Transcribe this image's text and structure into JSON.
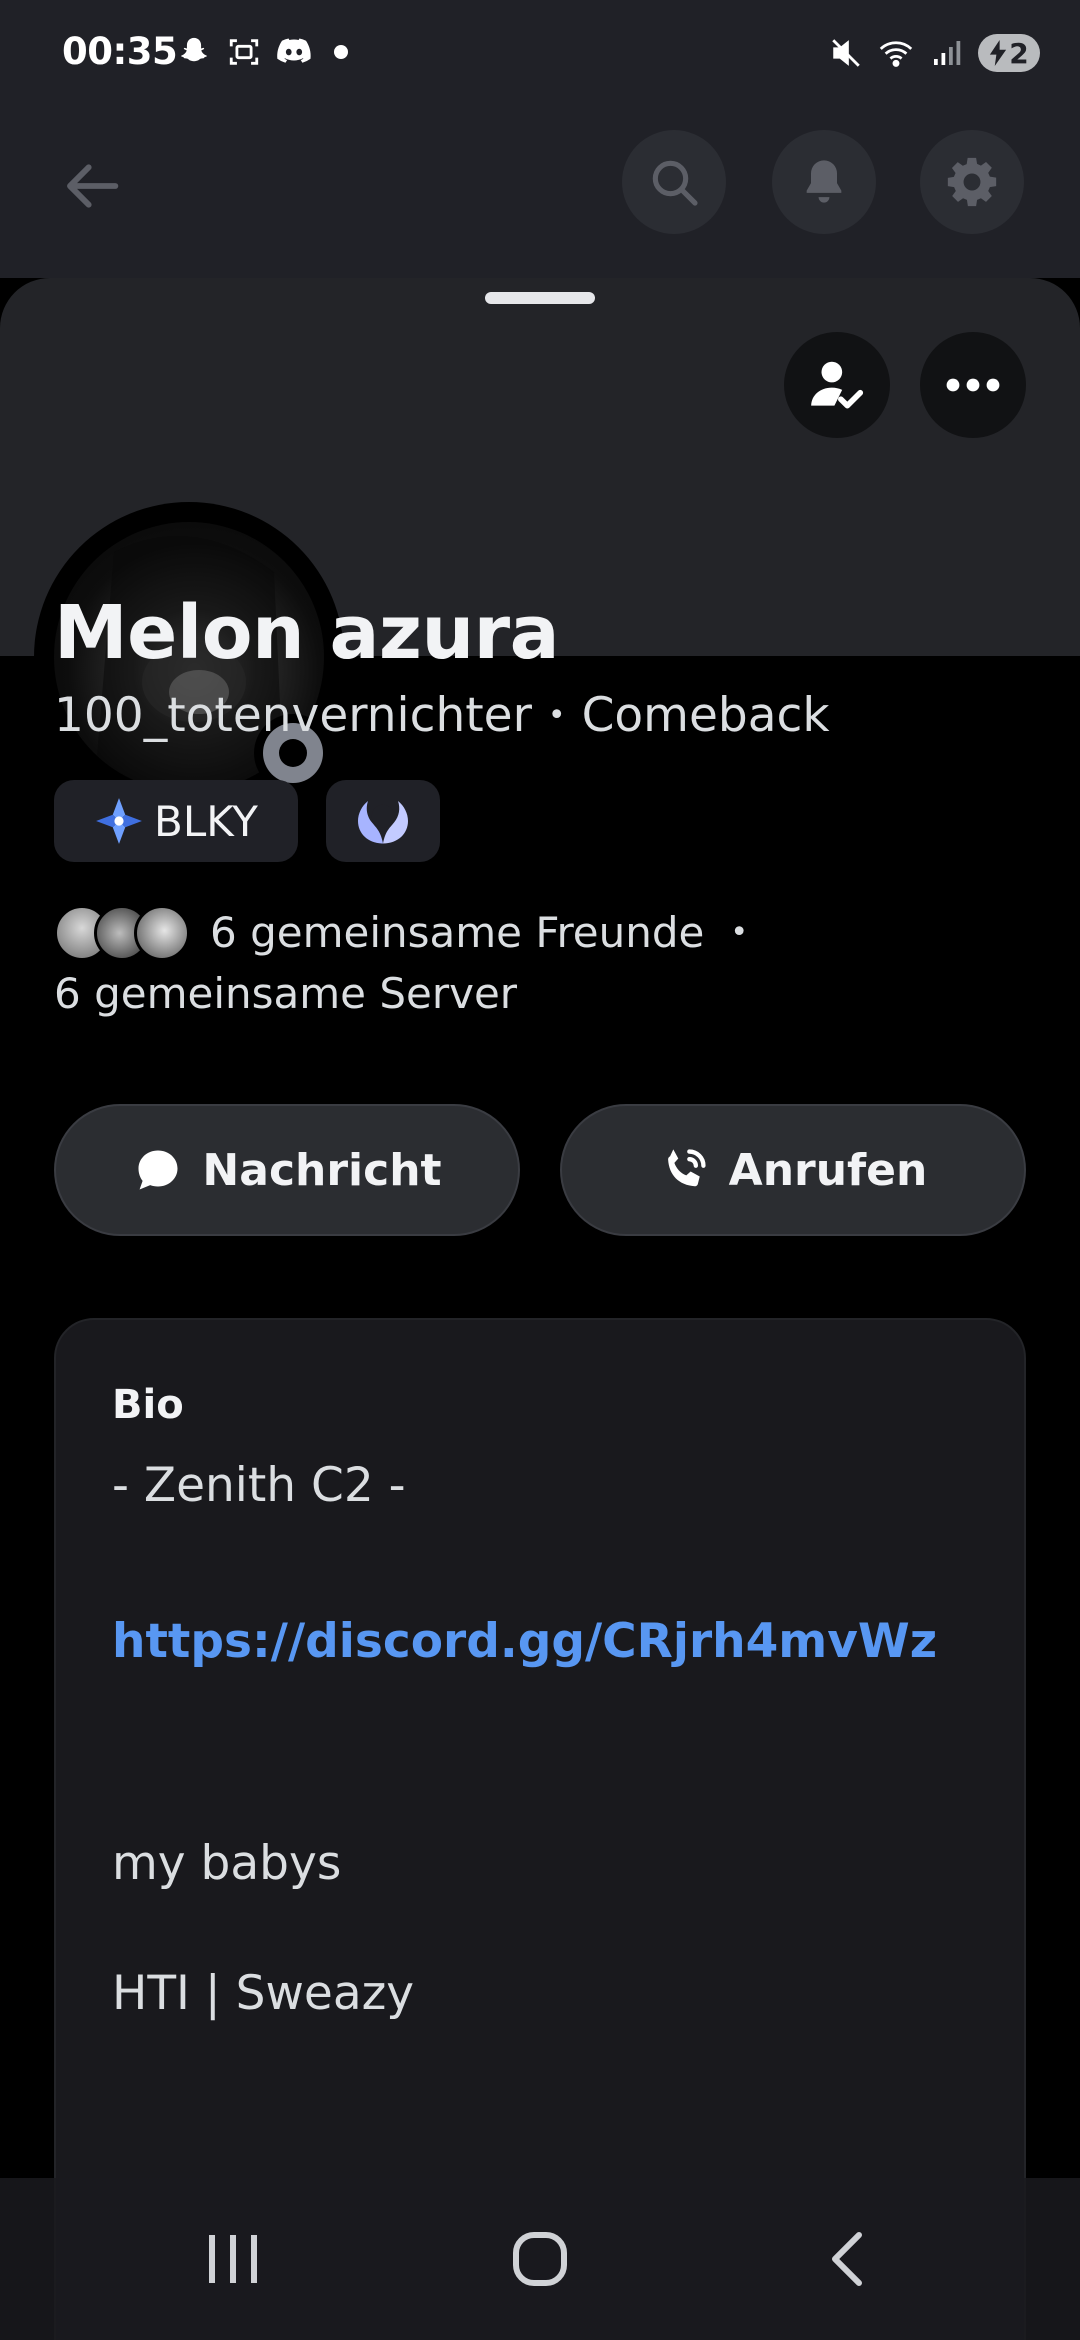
{
  "status_bar": {
    "time": "00:35",
    "battery": "2",
    "left_icons": [
      "snapchat-icon",
      "screenshot-icon",
      "discord-icon",
      "dot"
    ],
    "right_icons": [
      "mute-vibrate-icon",
      "wifi-icon",
      "signal-icon",
      "battery-icon"
    ]
  },
  "app_bar": {
    "icons": [
      "back-arrow-icon",
      "search-icon",
      "bell-icon",
      "gear-icon"
    ]
  },
  "profile": {
    "display_name": "Melon azura",
    "username": "100_totenvernichter",
    "separator": "•",
    "pronouns": "Comeback",
    "status": "offline",
    "tags": [
      {
        "label": "BLKY",
        "icon": "clan-badge-icon"
      },
      {
        "label": "",
        "icon": "laurel-badge-icon"
      }
    ],
    "mutual_friends": "6 gemeinsame Freunde",
    "mutual_separator": "•",
    "mutual_servers": "6 gemeinsame Server"
  },
  "actions": {
    "message_label": "Nachricht",
    "call_label": "Anrufen"
  },
  "bio": {
    "title": "Bio",
    "line1": "- Zenith C2 -",
    "link": "https://discord.gg/CRjrh4mvWz",
    "line3": "my babys",
    "line4": "HTI | Sweazy"
  },
  "colors": {
    "background": "#000000",
    "surface": "#202127",
    "banner": "#232428",
    "link": "#5897f2",
    "text_primary": "#f2f3f5",
    "status_offline": "#80848e"
  }
}
